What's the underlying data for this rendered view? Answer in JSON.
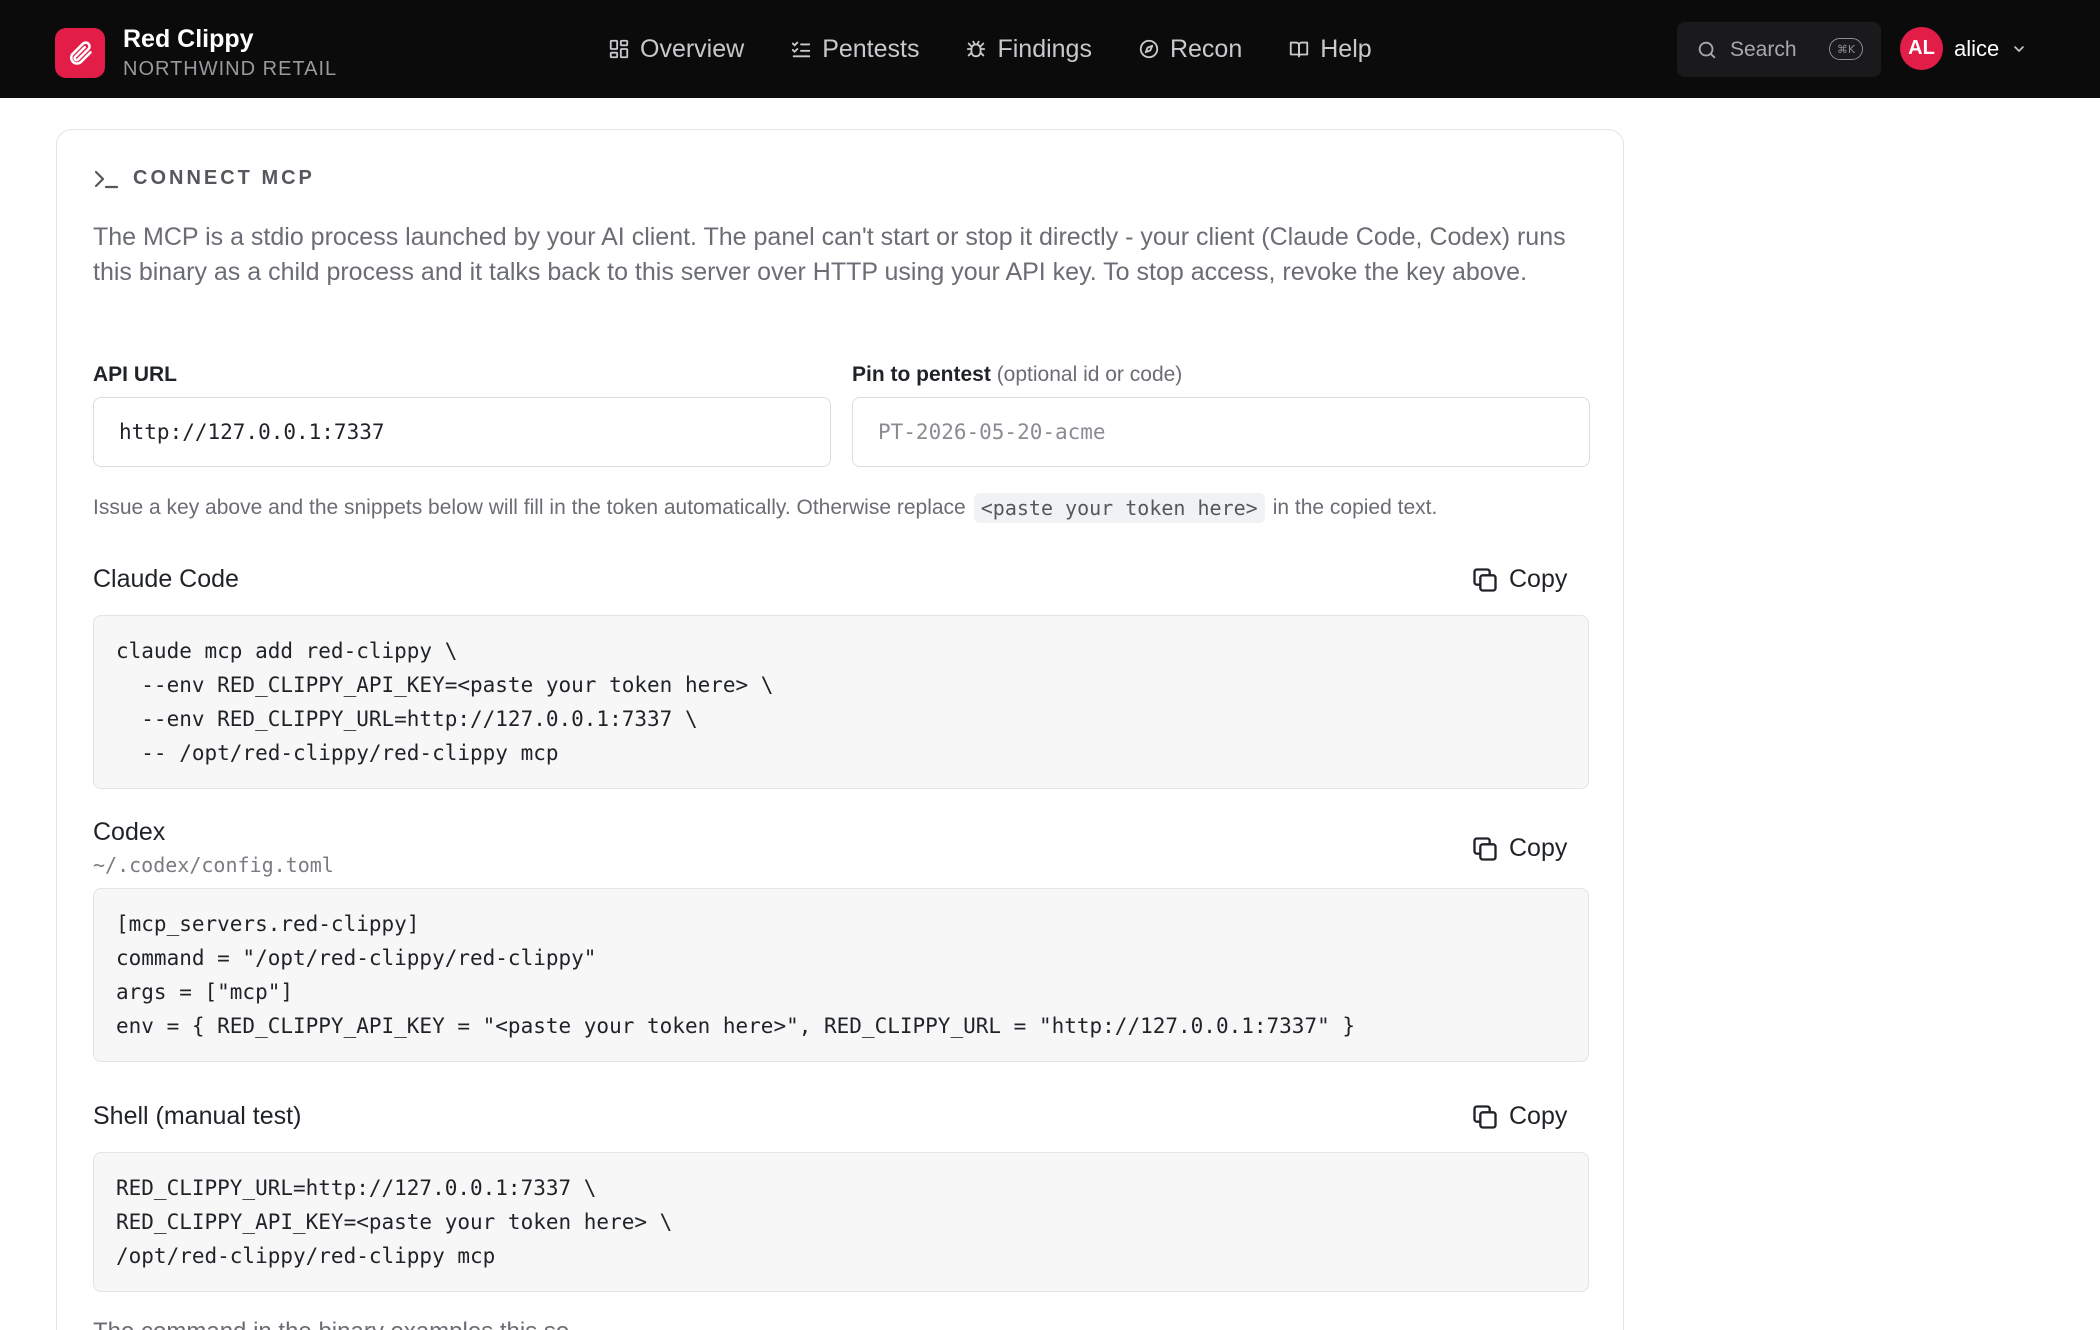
{
  "brand": {
    "name": "Red Clippy",
    "org": "NORTHWIND RETAIL"
  },
  "nav": [
    {
      "label": "Overview",
      "icon": "grid-icon"
    },
    {
      "label": "Pentests",
      "icon": "checklist-icon"
    },
    {
      "label": "Findings",
      "icon": "bug-icon"
    },
    {
      "label": "Recon",
      "icon": "compass-icon"
    },
    {
      "label": "Help",
      "icon": "book-icon"
    }
  ],
  "search": {
    "label": "Search",
    "shortcut": "⌘K"
  },
  "user": {
    "initials": "AL",
    "name": "alice"
  },
  "connect": {
    "title": "CONNECT MCP",
    "description": "The MCP is a stdio process launched by your AI client. The panel can't start or stop it directly - your client (Claude Code, Codex) runs this binary as a child process and it talks back to this server over HTTP using your API key. To stop access, revoke the key above.",
    "api_url_label": "API URL",
    "api_url_value": "http://127.0.0.1:7337",
    "pin_label": "Pin to pentest",
    "pin_label_hint": "(optional id or code)",
    "pin_placeholder": "PT-2026-05-20-acme",
    "hint_before": "Issue a key above and the snippets below will fill in the token automatically. Otherwise replace",
    "hint_code": "<paste your token here>",
    "hint_after": "in the copied text.",
    "copy_label": "Copy",
    "footnote": "The command in the binary examples this so..."
  },
  "snippets": {
    "claude": {
      "title": "Claude Code",
      "lines": [
        "claude mcp add red-clippy \\",
        "  --env RED_CLIPPY_API_KEY=<paste your token here> \\",
        "  --env RED_CLIPPY_URL=http://127.0.0.1:7337 \\",
        "  -- /opt/red-clippy/red-clippy mcp"
      ]
    },
    "codex": {
      "title": "Codex",
      "subtitle": "~/.codex/config.toml",
      "lines": [
        "[mcp_servers.red-clippy]",
        "command = \"/opt/red-clippy/red-clippy\"",
        "args = [\"mcp\"]",
        "env = { RED_CLIPPY_API_KEY = \"<paste your token here>\", RED_CLIPPY_URL = \"http://127.0.0.1:7337\" }"
      ]
    },
    "shell": {
      "title": "Shell (manual test)",
      "lines": [
        "RED_CLIPPY_URL=http://127.0.0.1:7337 \\",
        "RED_CLIPPY_API_KEY=<paste your token here> \\",
        "/opt/red-clippy/red-clippy mcp"
      ]
    }
  },
  "colors": {
    "accent": "#e11d48",
    "topbar": "#0b0b0c"
  }
}
